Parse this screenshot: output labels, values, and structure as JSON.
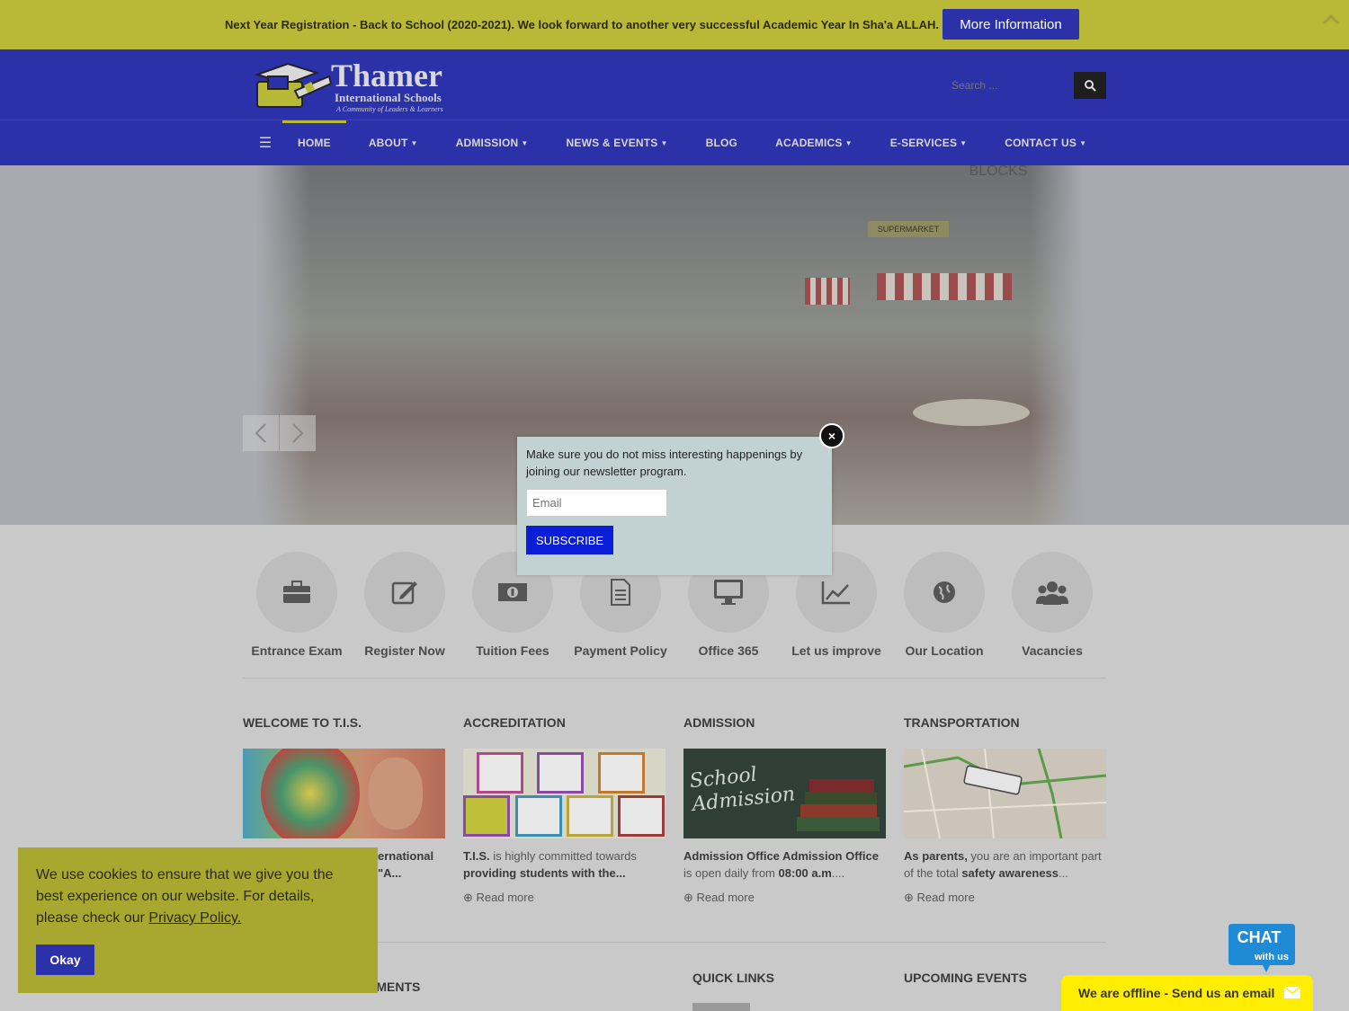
{
  "topbar": {
    "message": "Next Year Registration - Back to School (2020-2021). We look forward to another very successful Academic Year In Sha'a ALLAH.",
    "button": "More Information",
    "scroll_icon": "chevron-up-icon"
  },
  "logo": {
    "title": "Thamer",
    "subtitle": "International Schools",
    "tagline": "A Community of Leaders & Learners"
  },
  "search": {
    "placeholder": "Search ..."
  },
  "nav": {
    "items": [
      {
        "label": "HOME",
        "caret": false
      },
      {
        "label": "ABOUT",
        "caret": true
      },
      {
        "label": "ADMISSION",
        "caret": true
      },
      {
        "label": "NEWS & EVENTS",
        "caret": true
      },
      {
        "label": "BLOG",
        "caret": false
      },
      {
        "label": "ACADEMICS",
        "caret": true
      },
      {
        "label": "E-SERVICES",
        "caret": true
      },
      {
        "label": "CONTACT US",
        "caret": true
      }
    ]
  },
  "hero": {
    "signs": [
      "SUPERMARKET",
      "BLOCKS"
    ]
  },
  "quick_icons": [
    {
      "label": "Entrance Exam",
      "icon": "briefcase-icon"
    },
    {
      "label": "Register Now",
      "icon": "edit-icon"
    },
    {
      "label": "Tuition Fees",
      "icon": "money-icon"
    },
    {
      "label": "Payment Policy",
      "icon": "document-icon"
    },
    {
      "label": "Office 365",
      "icon": "monitor-icon"
    },
    {
      "label": "Let us improve",
      "icon": "line-chart-icon"
    },
    {
      "label": "Our Location",
      "icon": "globe-icon"
    },
    {
      "label": "Vacancies",
      "icon": "users-icon"
    }
  ],
  "cards": {
    "welcome": {
      "heading": "WELCOME TO T.I.S.",
      "text_a": "ernational",
      "text_b": "\"A..."
    },
    "accreditation": {
      "heading": "ACCREDITATION",
      "text_a": "T.I.S.",
      "text_b": " is highly committed towards",
      "text_c": "providing students with the...",
      "more": "Read more"
    },
    "admission": {
      "heading": "ADMISSION",
      "text_a": "Admission Office Admission Office",
      "text_b": "is open daily from ",
      "text_c": "08:00 a.m",
      "text_d": "....",
      "more": "Read more",
      "img_text": "School Admission"
    },
    "transportation": {
      "heading": "TRANSPORTATION",
      "text_a": "As parents,",
      "text_b": " you are an important part",
      "text_c": "of the total ",
      "text_d": "safety awareness",
      "text_e": "...",
      "more": "Read more"
    }
  },
  "bottom_headings": {
    "announcements": "EMENTS",
    "quick_links": "QUICK LINKS",
    "upcoming_events": "UPCOMING EVENTS"
  },
  "newsletter": {
    "text": "Make sure you do not miss interesting happenings by joining our newsletter program.",
    "email_placeholder": "Email",
    "button": "SUBSCRIBE"
  },
  "cookie": {
    "text": "We use cookies to ensure that we give you the best experience on our website. For details, please check our ",
    "link": "Privacy Policy.",
    "button": "Okay"
  },
  "chat": {
    "badge_top": "CHAT",
    "badge_bottom": "with us",
    "offline": "We are offline - Send us an email"
  }
}
